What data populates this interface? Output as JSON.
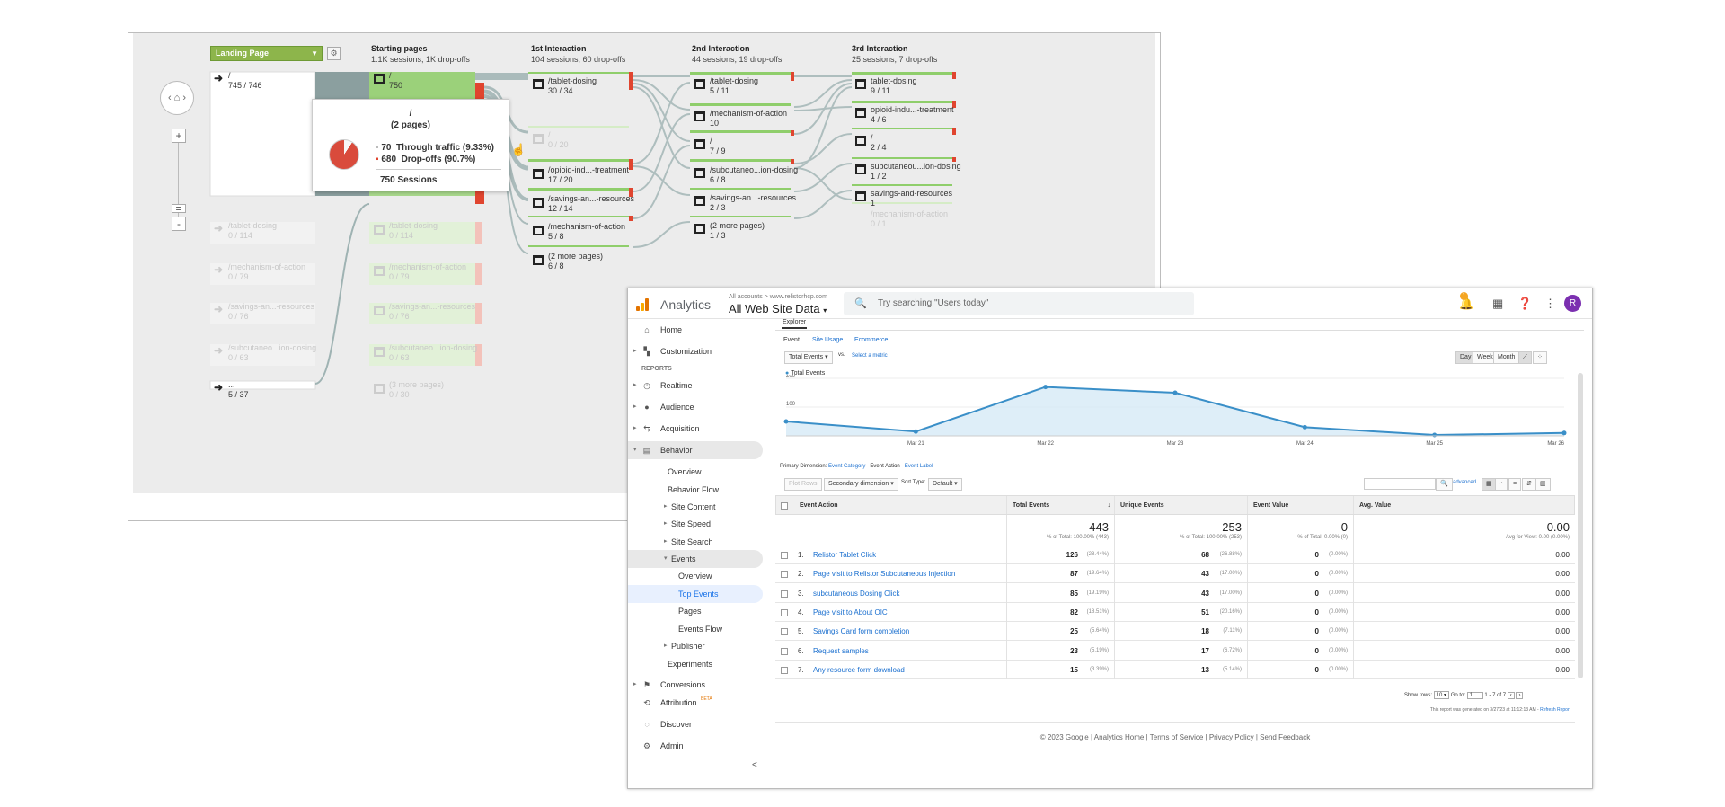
{
  "flow": {
    "landing_select": "Landing Page",
    "columns": [
      {
        "title": "Starting pages",
        "sub": "1.1K sessions, 1K drop-offs"
      },
      {
        "title": "1st Interaction",
        "sub": "104 sessions, 60 drop-offs"
      },
      {
        "title": "2nd Interaction",
        "sub": "44 sessions, 19 drop-offs"
      },
      {
        "title": "3rd Interaction",
        "sub": "25 sessions, 7 drop-offs"
      }
    ],
    "landing_nodes": [
      {
        "name": "/",
        "count": "745 / 746"
      },
      {
        "name": "/tablet-dosing",
        "count": "0 / 114"
      },
      {
        "name": "/mechanism-of-action",
        "count": "0 / 79"
      },
      {
        "name": "/savings-an...-resources",
        "count": "0 / 76"
      },
      {
        "name": "/subcutaneo...ion-dosing",
        "count": "0 / 63"
      },
      {
        "name": "...",
        "count": "5 / 37"
      }
    ],
    "starting_nodes": [
      {
        "name": "/",
        "count": "750"
      },
      {
        "name": "/tablet-dosing",
        "count": "0 / 114"
      },
      {
        "name": "/mechanism-of-action",
        "count": "0 / 79"
      },
      {
        "name": "/savings-an...-resources",
        "count": "0 / 76"
      },
      {
        "name": "/subcutaneo...ion-dosing",
        "count": "0 / 63"
      },
      {
        "name": "(3 more pages)",
        "count": "0 / 30"
      }
    ],
    "first_nodes": [
      {
        "name": "/tablet-dosing",
        "count": "30 / 34"
      },
      {
        "name": "/",
        "count": "0 / 20"
      },
      {
        "name": "/opioid-ind...-treatment",
        "count": "17 / 20"
      },
      {
        "name": "/savings-an...-resources",
        "count": "12 / 14"
      },
      {
        "name": "/mechanism-of-action",
        "count": "5 / 8"
      },
      {
        "name": "(2 more pages)",
        "count": "6 / 8"
      }
    ],
    "second_nodes": [
      {
        "name": "/tablet-dosing",
        "count": "5 / 11"
      },
      {
        "name": "/mechanism-of-action",
        "count": "10"
      },
      {
        "name": "/",
        "count": "7 / 9"
      },
      {
        "name": "/subcutaneo...ion-dosing",
        "count": "6 / 8"
      },
      {
        "name": "/savings-an...-resources",
        "count": "2 / 3"
      },
      {
        "name": "(2 more pages)",
        "count": "1 / 3"
      }
    ],
    "third_nodes": [
      {
        "name": "tablet-dosing",
        "count": "9 / 11"
      },
      {
        "name": "opioid-indu...-treatment",
        "count": "4 / 6"
      },
      {
        "name": "/",
        "count": "2 / 4"
      },
      {
        "name": "subcutaneou...ion-dosing",
        "count": "1 / 2"
      },
      {
        "name": "savings-and-resources",
        "count": "1"
      },
      {
        "name": "/mechanism-of-action",
        "count": "0 / 1"
      }
    ],
    "tooltip": {
      "title": "/",
      "pages": "(2 pages)",
      "through_value": "70",
      "through_label": "Through traffic (9.33%)",
      "drop_value": "680",
      "drop_label": "Drop-offs (90.7%)",
      "sessions": "750  Sessions"
    }
  },
  "ga": {
    "app_name": "Analytics",
    "breadcrumb": "All accounts > www.relistorhcp.com",
    "property": "All Web Site Data",
    "search_placeholder": "Try searching \"Users today\"",
    "notif_count": "1",
    "avatar_letter": "R",
    "sidebar": {
      "home": "Home",
      "customization": "Customization",
      "reports_heading": "REPORTS",
      "realtime": "Realtime",
      "audience": "Audience",
      "acquisition": "Acquisition",
      "behavior": "Behavior",
      "overview": "Overview",
      "behavior_flow": "Behavior Flow",
      "site_content": "Site Content",
      "site_speed": "Site Speed",
      "site_search": "Site Search",
      "events": "Events",
      "ev_overview": "Overview",
      "top_events": "Top Events",
      "pages": "Pages",
      "events_flow": "Events Flow",
      "publisher": "Publisher",
      "experiments": "Experiments",
      "conversions": "Conversions",
      "attribution": "Attribution",
      "attribution_badge": "BETA",
      "discover": "Discover",
      "admin": "Admin",
      "collapse": "<"
    },
    "explorer_tab": "Explorer",
    "subtabs": [
      "Event",
      "Site Usage",
      "Ecommerce"
    ],
    "metric_select": "Total Events",
    "vs": "vs.",
    "select_metric": "Select a metric",
    "period_buttons": [
      "Day",
      "Week",
      "Month"
    ],
    "legend": "Total Events",
    "primary_dim_label": "Primary Dimension:",
    "primary_dims": [
      "Event Category",
      "Event Action",
      "Event Label"
    ],
    "plot_rows": "Plot Rows",
    "secondary_dim": "Secondary dimension",
    "sort_type_label": "Sort Type:",
    "sort_type": "Default",
    "advanced": "advanced",
    "columns": [
      "Event Action",
      "Total Events",
      "Unique Events",
      "Event Value",
      "Avg. Value"
    ],
    "totals": [
      {
        "big": "443",
        "small": "% of Total: 100.00% (443)"
      },
      {
        "big": "253",
        "small": "% of Total: 100.00% (253)"
      },
      {
        "big": "0",
        "small": "% of Total: 0.00% (0)"
      },
      {
        "big": "0.00",
        "small": "Avg for View: 0.00 (0.00%)"
      }
    ],
    "rows": [
      {
        "n": "1.",
        "action": "Relistor Tablet Click",
        "total": "126",
        "total_pct": "(28.44%)",
        "unique": "68",
        "unique_pct": "(26.88%)",
        "value": "0",
        "value_pct": "(0.00%)",
        "avg": "0.00"
      },
      {
        "n": "2.",
        "action": "Page visit to Relistor Subcutaneous Injection",
        "total": "87",
        "total_pct": "(19.64%)",
        "unique": "43",
        "unique_pct": "(17.00%)",
        "value": "0",
        "value_pct": "(0.00%)",
        "avg": "0.00"
      },
      {
        "n": "3.",
        "action": "subcutaneous Dosing Click",
        "total": "85",
        "total_pct": "(19.19%)",
        "unique": "43",
        "unique_pct": "(17.00%)",
        "value": "0",
        "value_pct": "(0.00%)",
        "avg": "0.00"
      },
      {
        "n": "4.",
        "action": "Page visit to About OIC",
        "total": "82",
        "total_pct": "(18.51%)",
        "unique": "51",
        "unique_pct": "(20.16%)",
        "value": "0",
        "value_pct": "(0.00%)",
        "avg": "0.00"
      },
      {
        "n": "5.",
        "action": "Savings Card form completion",
        "total": "25",
        "total_pct": "(5.64%)",
        "unique": "18",
        "unique_pct": "(7.11%)",
        "value": "0",
        "value_pct": "(0.00%)",
        "avg": "0.00"
      },
      {
        "n": "6.",
        "action": "Request samples",
        "total": "23",
        "total_pct": "(5.19%)",
        "unique": "17",
        "unique_pct": "(6.72%)",
        "value": "0",
        "value_pct": "(0.00%)",
        "avg": "0.00"
      },
      {
        "n": "7.",
        "action": "Any resource form download",
        "total": "15",
        "total_pct": "(3.39%)",
        "unique": "13",
        "unique_pct": "(5.14%)",
        "value": "0",
        "value_pct": "(0.00%)",
        "avg": "0.00"
      }
    ],
    "show_rows_label": "Show rows:",
    "show_rows_value": "10",
    "goto_label": "Go to:",
    "goto_value": "1",
    "range": "1 - 7 of 7",
    "generated": "This report was generated on 3/27/23 at 11:12:13 AM -",
    "refresh": "Refresh Report",
    "footer": "© 2023 Google | Analytics Home | Terms of Service | Privacy Policy | Send Feedback",
    "colors": {
      "accent": "#1a73e8",
      "line": "#3a8fc8",
      "fill": "#d6eaf6",
      "flow_green": "#8fce6b",
      "drop_red": "#e0452f"
    }
  },
  "chart_data": {
    "type": "area",
    "series": [
      {
        "name": "Total Events",
        "values": [
          50,
          15,
          170,
          150,
          30,
          3,
          10
        ]
      }
    ],
    "categories": [
      "",
      "Mar 21",
      "Mar 22",
      "Mar 23",
      "Mar 24",
      "Mar 25",
      "Mar 26"
    ],
    "yticks": [
      "200",
      "100"
    ],
    "ylim": [
      0,
      200
    ]
  }
}
